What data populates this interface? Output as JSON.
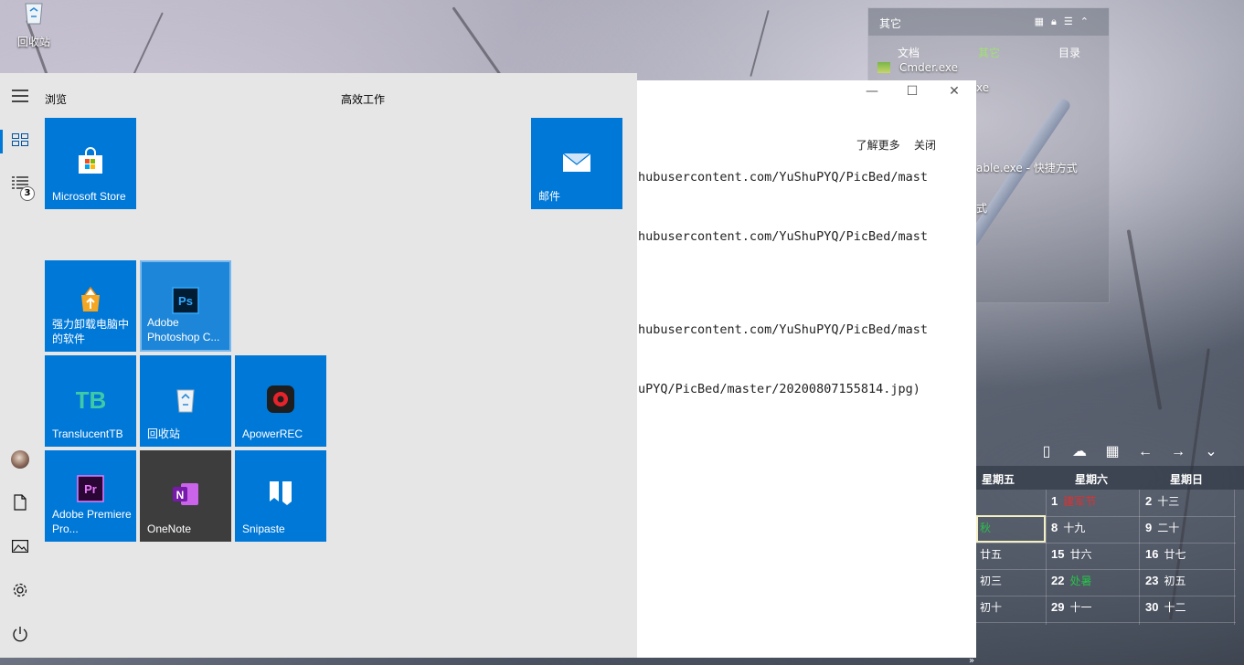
{
  "desktop": {
    "recycle_bin_label": "回收站"
  },
  "start_menu": {
    "group_browse": "浏览",
    "group_productive": "高效工作",
    "rail": {
      "hamburger_icon": "hamburger-icon",
      "tiles_icon": "tiles-icon",
      "list_icon": "list-icon",
      "list_badge": "3",
      "documents_icon": "document-icon",
      "pictures_icon": "picture-icon",
      "settings_icon": "gear-icon",
      "power_icon": "power-icon"
    },
    "tiles": {
      "store": "Microsoft Store",
      "mail": "邮件",
      "uninstaller": "强力卸载电脑中的软件",
      "photoshop": "Adobe Photoshop C...",
      "translucenttb": "TranslucentTB",
      "recycle": "回收站",
      "apowerrec": "ApowerREC",
      "premiere": "Adobe Premiere Pro...",
      "onenote": "OneNote",
      "snipaste": "Snipaste"
    },
    "colors": {
      "tile_blue": "#0078d7",
      "tile_dark": "#3d3d3d",
      "background": "#e6e6e6"
    }
  },
  "notepad": {
    "minimize": "—",
    "maximize": "☐",
    "close": "✕",
    "learn_more": "了解更多",
    "close_link": "关闭",
    "lines": [
      "hubusercontent.com/YuShuPYQ/PicBed/mast",
      "hubusercontent.com/YuShuPYQ/PicBed/mast",
      "hubusercontent.com/YuShuPYQ/PicBed/mast",
      "uPYQ/PicBed/master/20200807155814.jpg)"
    ]
  },
  "fence": {
    "title": "其它",
    "tabs": [
      "文档",
      "其它",
      "目录"
    ],
    "items": [
      "Cmder.exe",
      "xe",
      "able.exe - 快捷方式",
      "式"
    ]
  },
  "calendar": {
    "weekdays": [
      "星期五",
      "星期六",
      "星期日"
    ],
    "rows": [
      {
        "fri": "",
        "sat_num": "1",
        "sat_sub": "建军节",
        "sun_num": "2",
        "sun_sub": "十三"
      },
      {
        "fri": "秋",
        "sat_num": "8",
        "sat_sub": "十九",
        "sun_num": "9",
        "sun_sub": "二十"
      },
      {
        "fri": "廿五",
        "sat_num": "15",
        "sat_sub": "廿六",
        "sun_num": "16",
        "sun_sub": "廿七"
      },
      {
        "fri": "初三",
        "sat_num": "22",
        "sat_sub": "处暑",
        "sun_num": "23",
        "sun_sub": "初五"
      },
      {
        "fri": "初十",
        "sat_num": "29",
        "sat_sub": "十一",
        "sun_num": "30",
        "sun_sub": "十二"
      }
    ]
  }
}
